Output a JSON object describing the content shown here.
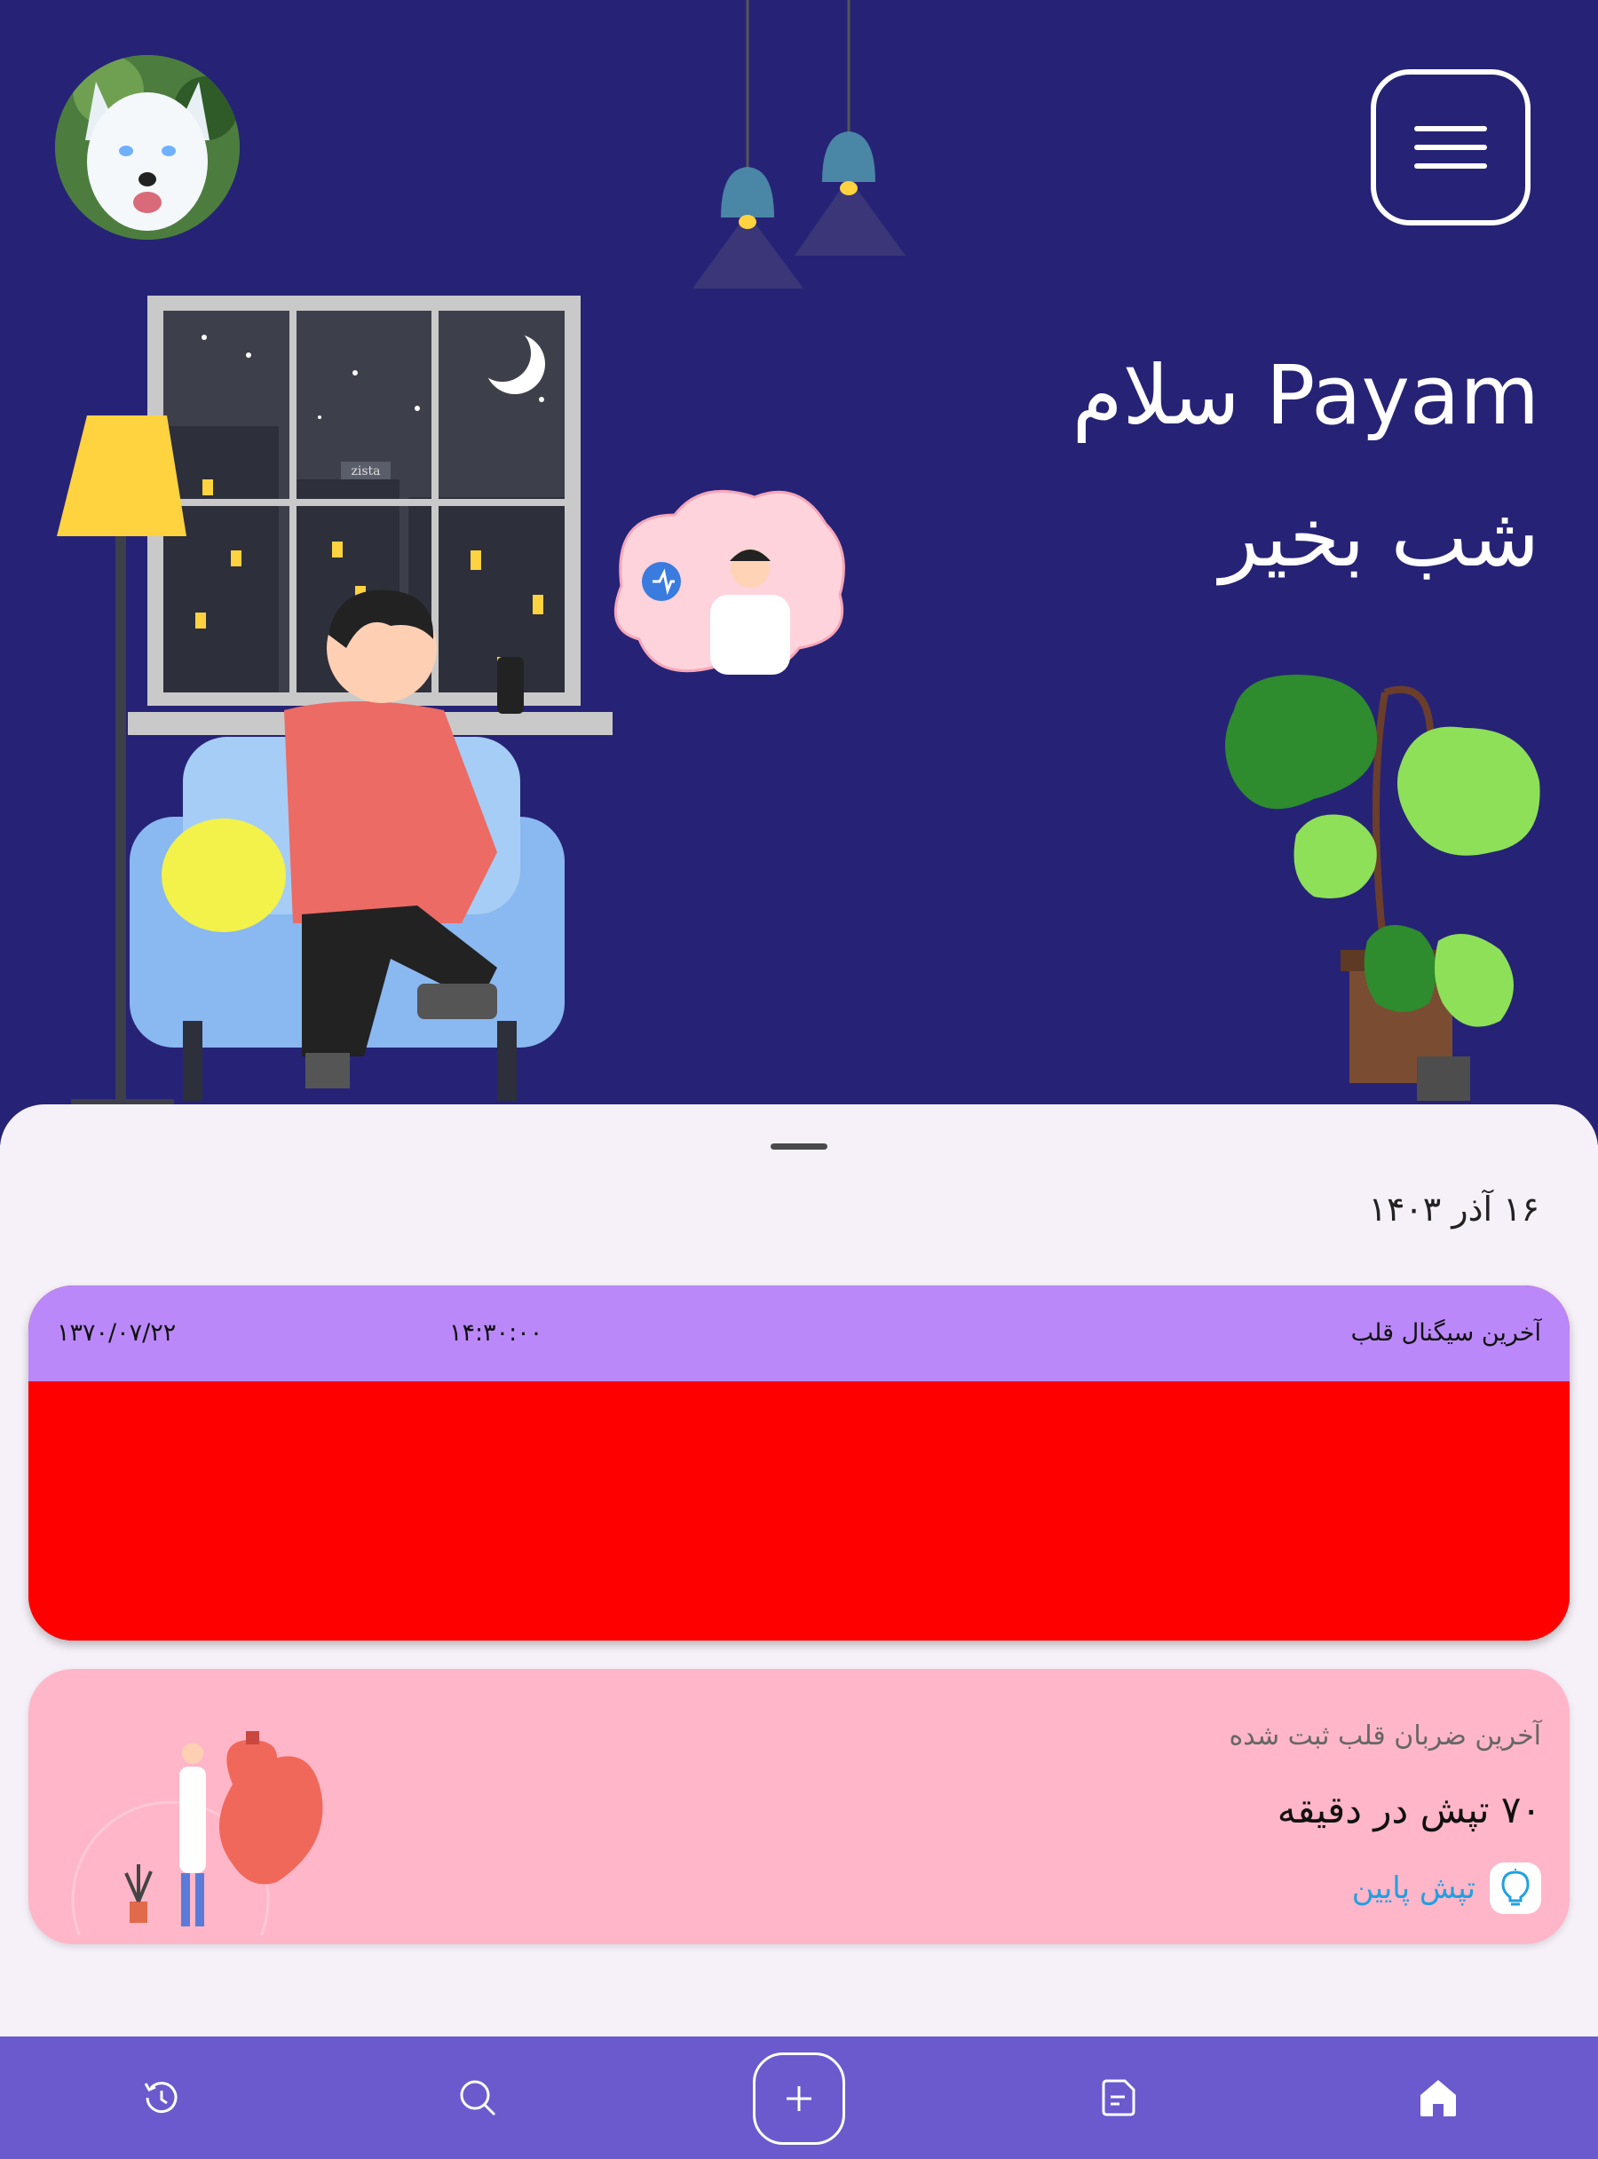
{
  "header": {
    "greeting": "سلام Payam",
    "time_greeting": "شب بخیر",
    "avatar_icon": "husky-avatar",
    "menu_icon": "hamburger-icon"
  },
  "illustration": {
    "building_sign": "zista"
  },
  "sheet": {
    "date": "۱۶ آذر ۱۴۰۳"
  },
  "ecg_card": {
    "title": "آخرین سیگنال قلب",
    "time": "۱۴:۳۰:۰۰",
    "date": "۱۳۷۰/۰۷/۲۲",
    "header_color": "#bb88f9",
    "body_color": "#ff0000"
  },
  "heart_rate_card": {
    "label": "آخرین ضربان قلب ثبت شده",
    "value": "۷۰ تپش در دقیقه",
    "status": "تپش پایین",
    "status_icon": "lightbulb-icon",
    "background": "#ffb6c8"
  },
  "nav": {
    "background": "#6a5acd",
    "items": [
      "home-icon",
      "document-icon",
      "add-icon",
      "search-icon",
      "history-icon"
    ]
  },
  "colors": {
    "hero_background": "#262376",
    "accent": "#bb88f9"
  }
}
